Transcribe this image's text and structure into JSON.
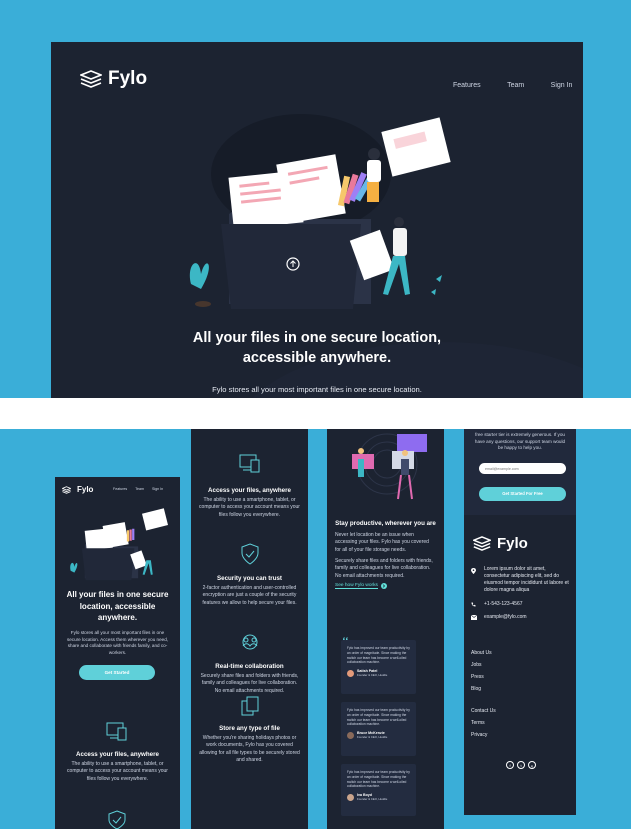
{
  "brand": "Fylo",
  "nav": {
    "features": "Features",
    "team": "Team",
    "signin": "Sign In"
  },
  "hero": {
    "title_line1": "All your files in one secure location,",
    "title_line2": "accessible anywhere.",
    "desc_partial": "Fylo stores all your most important files in one secure location."
  },
  "mobile": {
    "nav": {
      "features": "Features",
      "team": "Team",
      "signin": "Sign In"
    },
    "title": "All your files in one secure location, accessible anywhere.",
    "desc": "Fylo stores all your most important files in one secure location. Access them wherever you need, share and collaborate with friends family, and co-workers.",
    "cta": "Get Started"
  },
  "features": [
    {
      "title": "Access your files, anywhere",
      "desc": "The ability to use a smartphone, tablet, or computer to access your account means your files follow you everywhere.",
      "icon": "devices-icon"
    },
    {
      "title": "Security you can trust",
      "desc": "2-factor authentication and user-controlled encryption are just a couple of the security features we allow to help secure your files.",
      "icon": "shield-icon"
    },
    {
      "title": "Real-time collaboration",
      "desc": "Securely share files and folders with friends, family and colleagues for live collaboration. No email attachments required.",
      "icon": "collaboration-icon"
    },
    {
      "title": "Store any type of file",
      "desc": "Whether you're sharing holidays photos or work documents, Fylo has you covered allowing for all file types to be securely stored and shared.",
      "icon": "files-icon"
    }
  ],
  "productive": {
    "title": "Stay productive, wherever you are",
    "p1": "Never let location be an issue when accessing your files. Fylo has you covered for all of your file storage needs.",
    "p2": "Securely share files and folders with friends, family and colleagues for live collaboration. No email attachments required.",
    "link": "See how Fylo works"
  },
  "quote_mark": "“",
  "testimonials": [
    {
      "text": "Fylo has improved our team productivity by an order of magnitude. Since making the switch our team has become a well-oiled collaboration machine.",
      "name": "Satish Patel",
      "role": "Founder & CEO, Huddle"
    },
    {
      "text": "Fylo has improved our team productivity by an order of magnitude. Since making the switch our team has become a well-oiled collaboration machine.",
      "name": "Bruce McKenzie",
      "role": "Founder & CEO, Huddle"
    },
    {
      "text": "Fylo has improved our team productivity by an order of magnitude. Since making the switch our team has become a well-oiled collaboration machine.",
      "name": "Iva Boyd",
      "role": "Founder & CEO, Huddle"
    }
  ],
  "signup": {
    "text_partial": "free starter tier is extremely generous. If you have any questions, our support team would be happy to help you.",
    "email_placeholder": "email@example.com",
    "button": "Get Started For Free"
  },
  "footer": {
    "address": "Lorem ipsum dolor sit amet, consectetur adipiscing elit, sed do eiusmod tempor incididunt ut labore et dolore magna aliqua",
    "phone": "+1-543-123-4567",
    "email": "example@fylo.com",
    "links1": [
      "About Us",
      "Jobs",
      "Press",
      "Blog"
    ],
    "links2": [
      "Contact Us",
      "Terms",
      "Privacy"
    ],
    "social": [
      "f",
      "t",
      "ig"
    ]
  },
  "colors": {
    "page_bg": "#3aaed8",
    "dark_bg": "#1c2331",
    "card_bg": "#21293c",
    "accent": "#5fd0d9",
    "link": "#62e0d9"
  }
}
